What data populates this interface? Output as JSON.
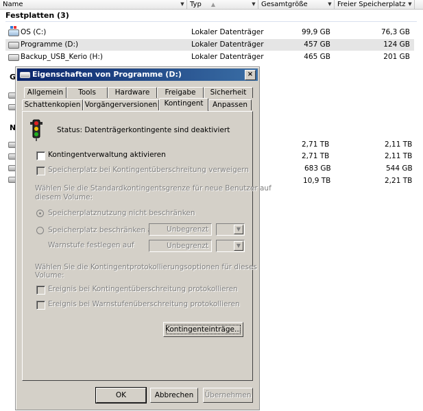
{
  "explorer": {
    "columns": {
      "name": "Name",
      "type": "Typ",
      "total": "Gesamtgröße",
      "free": "Freier Speicherplatz"
    },
    "group_title": "Festplatten (3)",
    "drives": [
      {
        "name": "OS (C:)",
        "type": "Lokaler Datenträger",
        "total": "99,9 GB",
        "free": "76,3 GB"
      },
      {
        "name": "Programme (D:)",
        "type": "Lokaler Datenträger",
        "total": "457 GB",
        "free": "124 GB"
      },
      {
        "name": "Backup_USB_Kerio (H:)",
        "type": "Lokaler Datenträger",
        "total": "465 GB",
        "free": "201 GB"
      }
    ],
    "partial_group_letters": [
      "G",
      "N"
    ],
    "net_rows": [
      {
        "total": "2,71 TB",
        "free": "2,11 TB"
      },
      {
        "total": "2,71 TB",
        "free": "2,11 TB"
      },
      {
        "total": "683 GB",
        "free": "544 GB"
      },
      {
        "total": "10,9 TB",
        "free": "2,21 TB"
      }
    ]
  },
  "dialog": {
    "title": "Eigenschaften von Programme (D:)",
    "close": "×",
    "tabs_row1": [
      "Allgemein",
      "Tools",
      "Hardware",
      "Freigabe",
      "Sicherheit"
    ],
    "tabs_row2": [
      "Schattenkopien",
      "Vorgängerversionen",
      "Kontingent",
      "Anpassen"
    ],
    "active_tab": "Kontingent",
    "status": "Status:  Datenträgerkontingente sind deaktiviert",
    "enable_quota": "Kontingentverwaltung aktivieren",
    "deny_space": "Speicherplatz bei Kontingentüberschreitung verweigern",
    "default_limit_text_1": "Wählen Sie die Standardkontingentsgrenze für neue Benutzer auf",
    "default_limit_text_2": "diesem Volume:",
    "no_limit": "Speicherplatznutzung nicht beschränken",
    "limit_to": "Speicherplatz beschränken auf",
    "limit_value": "Unbegrenzt",
    "warn_level": "Warnstufe festlegen auf",
    "warn_value": "Unbegrenzt",
    "log_text_1": "Wählen Sie die Kontingentprotokollierungsoptionen für dieses",
    "log_text_2": "Volume:",
    "log_exceed": "Ereignis bei Kontingentüberschreitung protokollieren",
    "log_warn": "Ereignis bei Warnstufenüberschreitung protokollieren",
    "entries_button": "Kontingenteinträge...",
    "ok": "OK",
    "cancel": "Abbrechen",
    "apply": "Übernehmen"
  }
}
